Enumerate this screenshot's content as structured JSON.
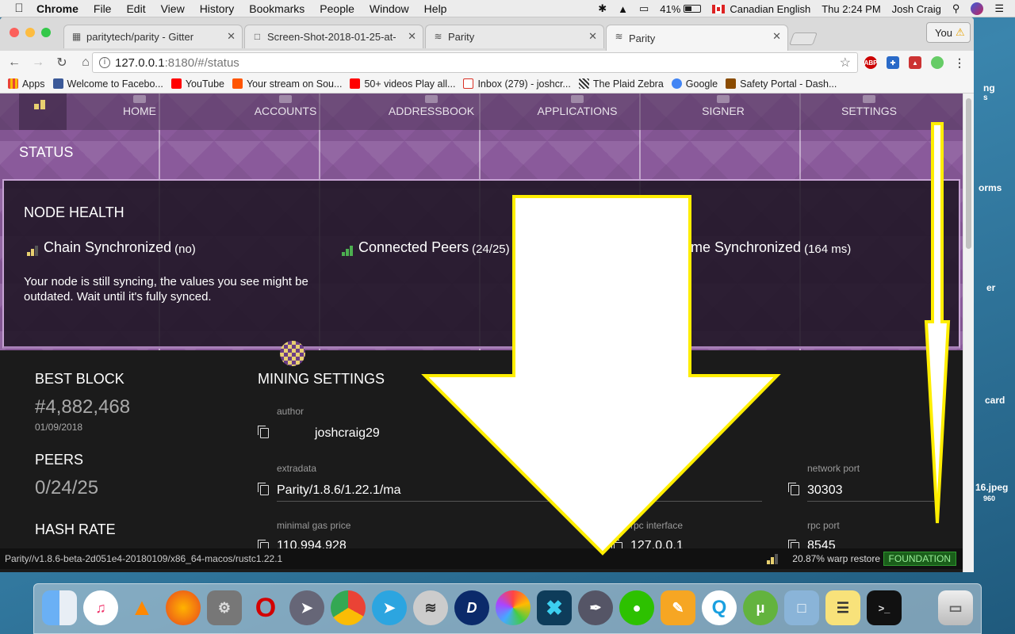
{
  "menubar": {
    "app": "Chrome",
    "menus": [
      "File",
      "Edit",
      "View",
      "History",
      "Bookmarks",
      "People",
      "Window",
      "Help"
    ],
    "battery": "41%",
    "input_source": "Canadian English",
    "clock": "Thu 2:24 PM",
    "user": "Josh Craig"
  },
  "browser": {
    "tabs": [
      {
        "title": "paritytech/parity - Gitter"
      },
      {
        "title": "Screen-Shot-2018-01-25-at-"
      },
      {
        "title": "Parity"
      },
      {
        "title": "Parity"
      }
    ],
    "profile_button": "You",
    "url_host": "127.0.0.1",
    "url_rest": ":8180/#/status",
    "bookmarks": [
      {
        "label": "Apps",
        "color": "#e94235"
      },
      {
        "label": "Welcome to Facebo...",
        "color": "#3b5998"
      },
      {
        "label": "YouTube",
        "color": "#ff0000"
      },
      {
        "label": "Your stream on Sou...",
        "color": "#ff5500"
      },
      {
        "label": "50+ videos Play all...",
        "color": "#ff0000"
      },
      {
        "label": "Inbox (279) - joshcr...",
        "color": "#d93025"
      },
      {
        "label": "The Plaid Zebra",
        "color": "#444444"
      },
      {
        "label": "Google",
        "color": "#4285f4"
      },
      {
        "label": "Safety Portal - Dash...",
        "color": "#8a4b00"
      }
    ]
  },
  "parity": {
    "nav": [
      "HOME",
      "ACCOUNTS",
      "ADDRESSBOOK",
      "APPLICATIONS",
      "SIGNER",
      "SETTINGS"
    ],
    "page_title": "STATUS",
    "health": {
      "title": "NODE HEALTH",
      "chain_label": "Chain Synchronized",
      "chain_value": "(no)",
      "peers_label": "Connected Peers",
      "peers_value": "(24/25)",
      "time_label": "me Synchronized",
      "time_value": "(164 ms)",
      "message": "Your node is still syncing, the values you see might be outdated. Wait until it's fully synced."
    },
    "best_block": {
      "label": "BEST BLOCK",
      "value": "#4,882,468",
      "date": "01/09/2018"
    },
    "peers": {
      "label": "PEERS",
      "value": "0/24/25"
    },
    "hash_rate": {
      "label": "HASH RATE"
    },
    "mining": {
      "title": "MINING SETTINGS",
      "author_label": "author",
      "author_value": "joshcraig29",
      "extradata_label": "extradata",
      "extradata_value": "Parity/1.8.6/1.22.1/ma",
      "gasprice_label": "minimal gas price",
      "gasprice_value": "110,994,928",
      "network_port_label": "network port",
      "network_port_value": "30303",
      "rpc_interface_label": "rpc interface",
      "rpc_interface_value": "127.0.0.1",
      "rpc_port_label": "rpc port",
      "rpc_port_value": "8545"
    },
    "statusbar": {
      "version": "Parity//v1.8.6-beta-2d051e4-20180109/x86_64-macos/rustc1.22.1",
      "warp": "20.87% warp restore",
      "badge": "FOUNDATION"
    }
  },
  "desktop_labels": [
    "ng",
    "s",
    "orms",
    "er",
    "card",
    "16.jpeg",
    "960"
  ],
  "colors": {
    "annotation": "#ffee00",
    "parity_purple": "#8a5a9b",
    "foundation_green": "#1a5e1a"
  }
}
